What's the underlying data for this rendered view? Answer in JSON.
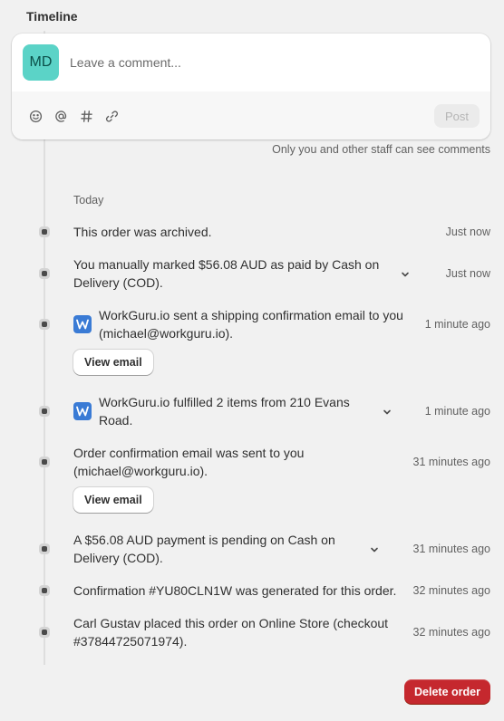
{
  "timeline": {
    "title": "Timeline",
    "avatar_initials": "MD",
    "comment_placeholder": "Leave a comment...",
    "toolbar_icons": [
      "emoji-icon",
      "mention-icon",
      "hashtag-icon",
      "link-icon"
    ],
    "post_label": "Post",
    "staff_note": "Only you and other staff can see comments",
    "section_label": "Today",
    "events": [
      {
        "lines": [
          "This order was archived."
        ],
        "time": "Just now",
        "expandable": false
      },
      {
        "lines": [
          "You manually marked $56.08 AUD as paid by Cash on",
          "Delivery (COD)."
        ],
        "time": "Just now",
        "expandable": true
      },
      {
        "lines": [
          "WorkGuru.io sent a shipping confirmation email to you",
          "(michael@workguru.io)."
        ],
        "time": "1 minute ago",
        "app_icon": true,
        "button": "View email"
      },
      {
        "lines": [
          "WorkGuru.io fulfilled 2 items from 210 Evans",
          "Road."
        ],
        "time": "1 minute ago",
        "app_icon": true,
        "expandable": true
      },
      {
        "lines": [
          "Order confirmation email was sent to you",
          "(michael@workguru.io)."
        ],
        "time": "31 minutes ago",
        "button": "View email"
      },
      {
        "lines": [
          "A $56.08 AUD payment is pending on Cash on",
          "Delivery (COD)."
        ],
        "time": "31 minutes ago",
        "expandable": true
      },
      {
        "lines": [
          "Confirmation #YU80CLN1W was generated for this order."
        ],
        "time": "32 minutes ago"
      },
      {
        "lines": [
          "Carl Gustav placed this order on Online Store (checkout",
          "#37844725071974)."
        ],
        "time": "32 minutes ago"
      }
    ],
    "delete_label": "Delete order",
    "colors": {
      "avatar": "#5bd3c7",
      "delete": "#c5282e",
      "app_icon": "#3a7bd5"
    }
  }
}
